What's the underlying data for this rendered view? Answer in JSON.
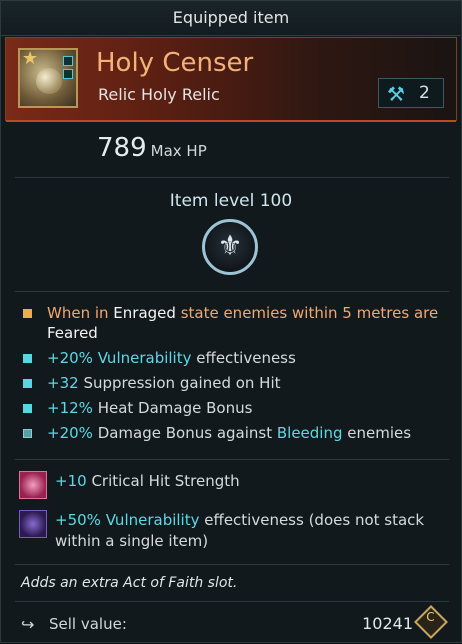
{
  "window": {
    "title": "Equipped item"
  },
  "item": {
    "name": "Holy Censer",
    "subtitle": "Relic Holy Relic",
    "forge_count": "2",
    "icon": "holy-censer-icon",
    "stat_value": "789",
    "stat_label": "Max HP",
    "item_level": "Item level 100",
    "emblem_icon": "fleur-de-lis-icon"
  },
  "modifiers": [
    {
      "parts": [
        "When in ",
        "Enraged",
        " state enemies within 5 metres are ",
        "Feared"
      ],
      "bullet": "gold"
    },
    {
      "parts": [
        "+20% ",
        "Vulnerability",
        " effectiveness"
      ],
      "bullet": "cyan"
    },
    {
      "parts": [
        "+32 ",
        "Suppression gained on Hit"
      ],
      "bullet": "cyan"
    },
    {
      "parts": [
        "+12% ",
        "Heat Damage Bonus"
      ],
      "bullet": "cyan"
    },
    {
      "parts": [
        "+20% ",
        "Damage Bonus against ",
        "Bleeding",
        " enemies"
      ],
      "bullet": "teal"
    }
  ],
  "bonuses": [
    {
      "parts": [
        "+10 ",
        "Critical Hit Strength"
      ],
      "icon": "critical-strike-icon"
    },
    {
      "parts": [
        "+50% ",
        "Vulnerability",
        " effectiveness (does not stack within a single item)"
      ],
      "icon": "relic-socket-icon"
    }
  ],
  "description": "Adds an extra Act of Faith slot.",
  "footer": {
    "sell_label": "Sell value:",
    "sell_value": "10241",
    "currency_icon": "currency-coin-icon",
    "currency_glyph": "C"
  },
  "colors": {
    "accent_orange": "#f2a870",
    "accent_cyan": "#5ed8e6",
    "header_red": "#7a2a18"
  }
}
